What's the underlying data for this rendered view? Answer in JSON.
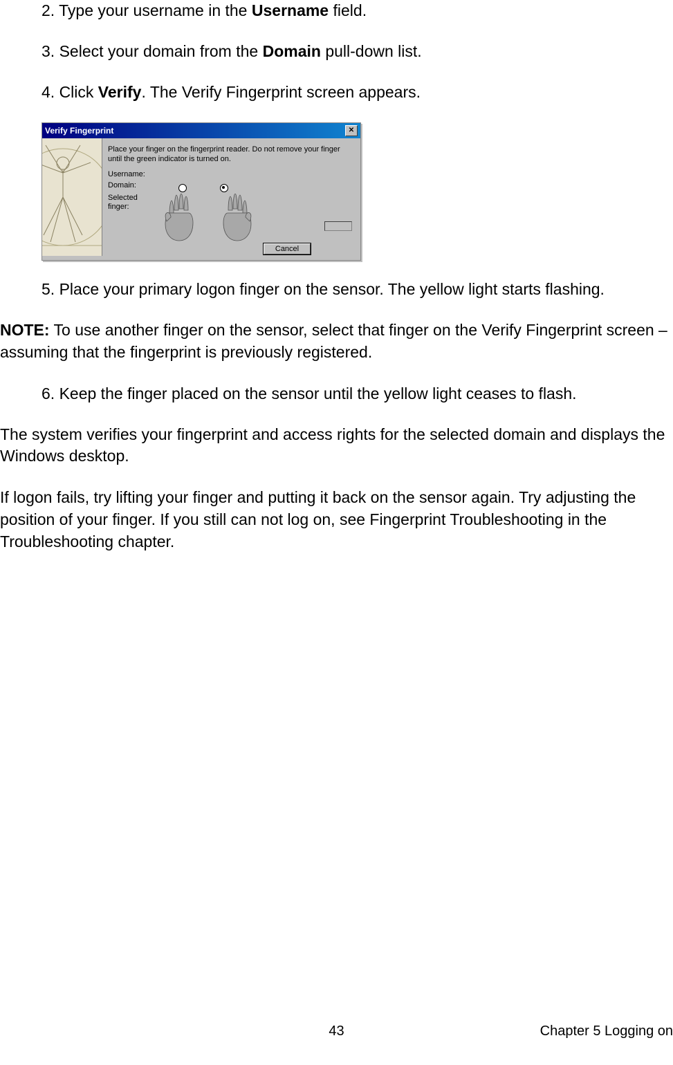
{
  "steps": {
    "s2_a": "2. Type your username in the ",
    "s2_b": "Username",
    "s2_c": " field.",
    "s3_a": "3. Select your domain from the ",
    "s3_b": "Domain",
    "s3_c": " pull-down list.",
    "s4_a": "4. Click ",
    "s4_b": "Verify",
    "s4_c": ". The Verify Fingerprint screen appears.",
    "s5": "5. Place your primary logon finger on the sensor. The yellow light starts flashing.",
    "s6": "6. Keep the finger placed on the sensor until the yellow light ceases to flash."
  },
  "note": {
    "label": "NOTE:",
    "text": " To use another finger on the sensor, select that finger on the Verify Fingerprint screen – assuming that the fingerprint is previously registered."
  },
  "para1": "The system verifies your fingerprint and access rights for the selected domain and displays the Windows desktop.",
  "para2": "If logon fails, try lifting your finger and putting it back on the sensor again. Try adjusting the position of your finger. If you still can not log on, see Fingerprint Troubleshooting in the Troubleshooting chapter.",
  "dialog": {
    "title": "Verify Fingerprint",
    "close_glyph": "✕",
    "instr": "Place your finger on the fingerprint reader. Do not remove your finger until the green indicator is turned on.",
    "username_label": "Username:",
    "domain_label": "Domain:",
    "selected_finger_label": "Selected finger:",
    "cancel_label": "Cancel"
  },
  "footer": {
    "page": "43",
    "chapter": "Chapter 5 Logging on"
  }
}
